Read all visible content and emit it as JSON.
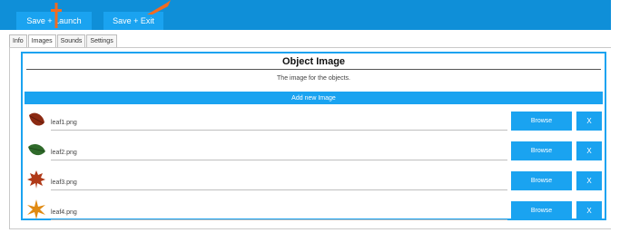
{
  "toolbar": {
    "save_launch_label": "Save + Launch",
    "save_exit_label": "Save + Exit",
    "background_color": "#0f8fd8",
    "button_color": "#1aa3f0",
    "annotation_color": "#f26b21"
  },
  "tabs": [
    {
      "label": "Info",
      "active": false
    },
    {
      "label": "Images",
      "active": true
    },
    {
      "label": "Sounds",
      "active": false
    },
    {
      "label": "Settings",
      "active": false
    }
  ],
  "panel": {
    "title": "Object Image",
    "description": "The image for the objects.",
    "add_button_label": "Add new Image",
    "browse_label": "Browse",
    "remove_label": "X"
  },
  "images": [
    {
      "file": "leaf1.png",
      "icon": "brown-leaf-icon"
    },
    {
      "file": "leaf2.png",
      "icon": "green-leaf-icon"
    },
    {
      "file": "leaf3.png",
      "icon": "maple-leaf-icon"
    },
    {
      "file": "leaf4.png",
      "icon": "star-leaf-icon"
    }
  ]
}
